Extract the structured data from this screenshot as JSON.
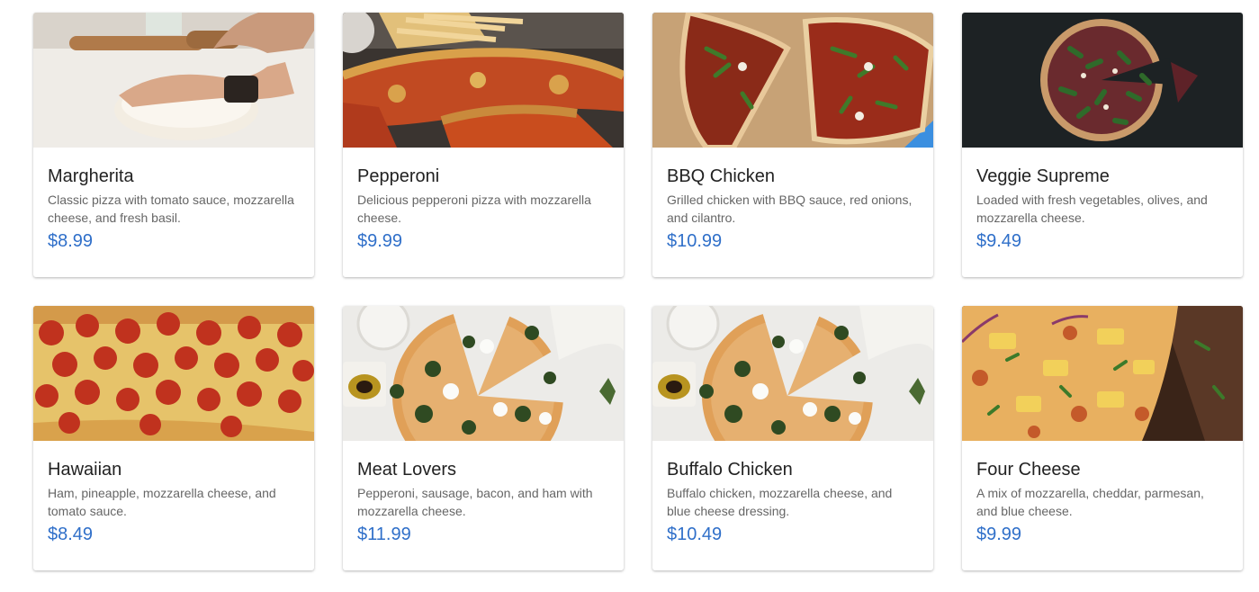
{
  "menu": {
    "items": [
      {
        "name": "Margherita",
        "description": "Classic pizza with tomato sauce, mozzarella cheese, and fresh basil.",
        "price": "$8.99",
        "image": "dough-kneading-photo"
      },
      {
        "name": "Pepperoni",
        "description": "Delicious pepperoni pizza with mozzarella cheese.",
        "price": "$9.99",
        "image": "pizza-slices-fries-photo"
      },
      {
        "name": "BBQ Chicken",
        "description": "Grilled chicken with BBQ sauce, red onions, and cilantro.",
        "price": "$10.99",
        "image": "arugula-pizza-photo"
      },
      {
        "name": "Veggie Supreme",
        "description": "Loaded with fresh vegetables, olives, and mozzarella cheese.",
        "price": "$9.49",
        "image": "dark-veggie-pizza-photo"
      },
      {
        "name": "Hawaiian",
        "description": "Ham, pineapple, mozzarella cheese, and tomato sauce.",
        "price": "$8.49",
        "image": "pepperoni-closeup-photo"
      },
      {
        "name": "Meat Lovers",
        "description": "Pepperoni, sausage, bacon, and ham with mozzarella cheese.",
        "price": "$11.99",
        "image": "spinach-mozzarella-pizza-photo"
      },
      {
        "name": "Buffalo Chicken",
        "description": "Buffalo chicken, mozzarella cheese, and blue cheese dressing.",
        "price": "$10.49",
        "image": "spinach-mozzarella-pizza-photo"
      },
      {
        "name": "Four Cheese",
        "description": "A mix of mozzarella, cheddar, parmesan, and blue cheese.",
        "price": "$9.99",
        "image": "pineapple-pizza-photo"
      }
    ]
  },
  "colors": {
    "price": "#2f6fc9",
    "title": "#222222",
    "description": "#666666"
  }
}
